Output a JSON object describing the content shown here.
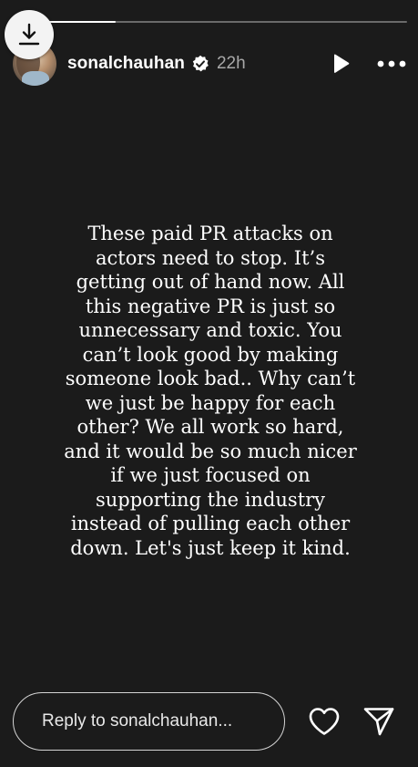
{
  "story": {
    "progress_fraction": 0.26,
    "user": {
      "username": "sonalchauhan",
      "verified": true,
      "time_ago": "22h",
      "avatar_icon": "avatar"
    },
    "controls": {
      "download_icon": "download-icon",
      "play_icon": "play-icon",
      "more_icon": "more-options-icon"
    },
    "text": "These paid PR attacks on actors need to stop. It’s getting out of hand now. All this negative PR is just so unnecessary and toxic. You can’t look good by making someone look bad.. Why can’t we just be happy for each other? We all work so hard, and it would be so much nicer if we just focused on supporting the industry instead of pulling each other down. Let's just keep it kind.",
    "text_lines": [
      "These paid PR attacks on",
      "actors need to stop. It’s",
      "getting out of hand now. All",
      "this negative PR is just so",
      "unnecessary and toxic. You",
      "can’t look good by making",
      "someone look bad.. Why can’t",
      "we just be happy for each",
      "other? We all work so hard,",
      "and it would be so much nicer",
      "if we just focused on",
      "supporting the industry",
      "instead of pulling each other",
      "down. Let's just keep it kind."
    ]
  },
  "footer": {
    "reply_placeholder": "Reply to sonalchauhan...",
    "like_icon": "heart-icon",
    "share_icon": "send-icon"
  },
  "colors": {
    "background": "#1b1b1b",
    "text": "#ffffff",
    "muted": "#a8a8a8"
  }
}
